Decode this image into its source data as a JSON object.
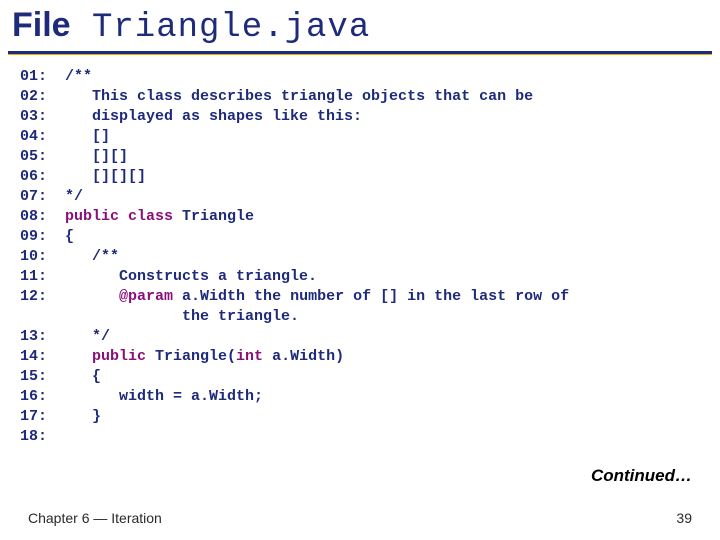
{
  "title": {
    "prefix": "File",
    "filename": " Triangle.java"
  },
  "code": {
    "lines": [
      {
        "num": "01:",
        "prefix": " ",
        "segs": [
          {
            "t": "/**",
            "k": false
          }
        ]
      },
      {
        "num": "02:",
        "prefix": "    ",
        "segs": [
          {
            "t": "This class describes triangle objects that can be",
            "k": false
          }
        ]
      },
      {
        "num": "03:",
        "prefix": "    ",
        "segs": [
          {
            "t": "displayed as shapes like this:",
            "k": false
          }
        ]
      },
      {
        "num": "04:",
        "prefix": "    ",
        "segs": [
          {
            "t": "[]",
            "k": false
          }
        ]
      },
      {
        "num": "05:",
        "prefix": "    ",
        "segs": [
          {
            "t": "[][]",
            "k": false
          }
        ]
      },
      {
        "num": "06:",
        "prefix": "    ",
        "segs": [
          {
            "t": "[][][]",
            "k": false
          }
        ]
      },
      {
        "num": "07:",
        "prefix": " ",
        "segs": [
          {
            "t": "*/",
            "k": false
          }
        ]
      },
      {
        "num": "08:",
        "prefix": " ",
        "segs": [
          {
            "t": "public class",
            "k": true
          },
          {
            "t": " Triangle",
            "k": false
          }
        ]
      },
      {
        "num": "09:",
        "prefix": " ",
        "segs": [
          {
            "t": "{",
            "k": false
          }
        ]
      },
      {
        "num": "10:",
        "prefix": "    ",
        "segs": [
          {
            "t": "/**",
            "k": false
          }
        ]
      },
      {
        "num": "11:",
        "prefix": "       ",
        "segs": [
          {
            "t": "Constructs a triangle.",
            "k": false
          }
        ]
      },
      {
        "num": "12:",
        "prefix": "       ",
        "segs": [
          {
            "t": "@param",
            "k": true
          },
          {
            "t": " a.Width the number of [] in the last row of",
            "k": false
          }
        ]
      },
      {
        "num": "",
        "prefix": "              ",
        "segs": [
          {
            "t": "the triangle.",
            "k": false
          }
        ]
      },
      {
        "num": "13:",
        "prefix": "    ",
        "segs": [
          {
            "t": "*/",
            "k": false
          }
        ]
      },
      {
        "num": "14:",
        "prefix": "    ",
        "segs": [
          {
            "t": "public",
            "k": true
          },
          {
            "t": " Triangle(",
            "k": false
          },
          {
            "t": "int",
            "k": true
          },
          {
            "t": " a.Width)",
            "k": false
          }
        ]
      },
      {
        "num": "15:",
        "prefix": "    ",
        "segs": [
          {
            "t": "{",
            "k": false
          }
        ]
      },
      {
        "num": "16:",
        "prefix": "       ",
        "segs": [
          {
            "t": "width = a.Width;",
            "k": false
          }
        ]
      },
      {
        "num": "17:",
        "prefix": "    ",
        "segs": [
          {
            "t": "}",
            "k": false
          }
        ]
      },
      {
        "num": "18:",
        "prefix": "",
        "segs": []
      }
    ]
  },
  "continued": "Continued…",
  "footer": {
    "left": "Chapter 6 — Iteration",
    "right": "39"
  }
}
